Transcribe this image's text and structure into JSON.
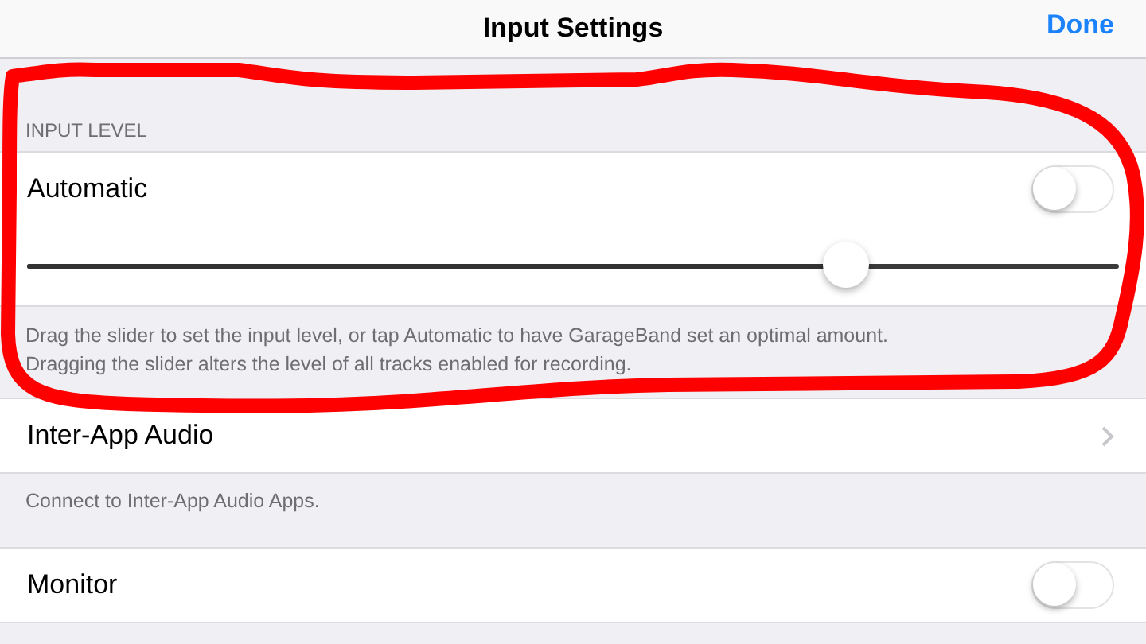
{
  "nav": {
    "title": "Input Settings",
    "done": "Done"
  },
  "input_level": {
    "header": "INPUT LEVEL",
    "automatic": {
      "label": "Automatic",
      "on": false
    },
    "slider": {
      "level": 0.75
    },
    "footer": [
      "Drag the slider to set the input level, or tap Automatic to have GarageBand set an optimal amount.",
      "Dragging the slider alters the level of all tracks enabled for recording."
    ]
  },
  "inter_app_audio": {
    "label": "Inter-App Audio",
    "footer": "Connect to Inter-App Audio Apps."
  },
  "monitor": {
    "label": "Monitor",
    "on": false
  },
  "annotation": {
    "kind": "scribble",
    "color": "#ff0000"
  }
}
